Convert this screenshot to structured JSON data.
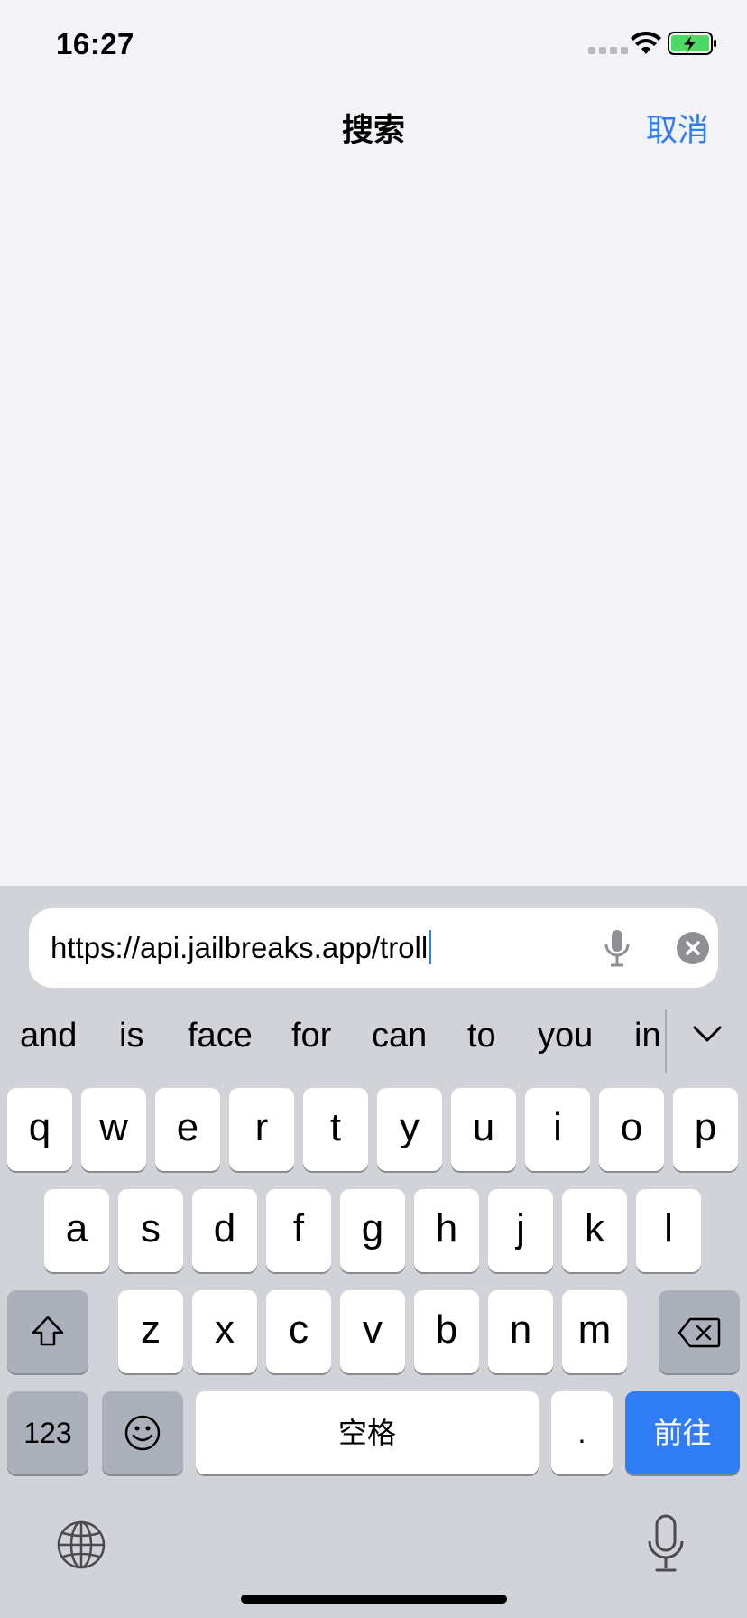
{
  "status_bar": {
    "time": "16:27",
    "icons": [
      "signal-dots-icon",
      "wifi-icon",
      "battery-charging-icon"
    ],
    "battery_color": "#4cd964"
  },
  "nav": {
    "title": "搜索",
    "cancel_label": "取消"
  },
  "search": {
    "value": "https://api.jailbreaks.app/troll",
    "icons": [
      "microphone-icon",
      "clear-icon"
    ]
  },
  "suggestions": [
    "and",
    "is",
    "face",
    "for",
    "can",
    "to",
    "you",
    "in"
  ],
  "keyboard": {
    "row1": [
      "q",
      "w",
      "e",
      "r",
      "t",
      "y",
      "u",
      "i",
      "o",
      "p"
    ],
    "row2": [
      "a",
      "s",
      "d",
      "f",
      "g",
      "h",
      "j",
      "k",
      "l"
    ],
    "row3": [
      "z",
      "x",
      "c",
      "v",
      "b",
      "n",
      "m"
    ],
    "numbers_label": "123",
    "space_label": "空格",
    "dot_label": ".",
    "go_label": "前往",
    "icons": [
      "shift-icon",
      "backspace-icon",
      "emoji-icon",
      "globe-icon",
      "dictation-microphone-icon"
    ]
  },
  "colors": {
    "accent": "#2f7cf6",
    "background": "#f2f2f7",
    "keyboard_bg": "#d1d3d9",
    "function_key": "#abb0ba"
  }
}
